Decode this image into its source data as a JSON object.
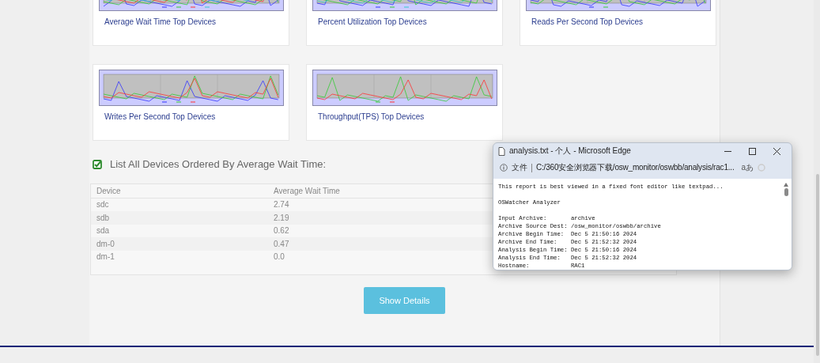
{
  "report_cards": [
    {
      "title": "Average Wait Time Top Devices"
    },
    {
      "title": "Percent Utilization Top Devices"
    },
    {
      "title": "Reads Per Second Top Devices"
    },
    {
      "title": "Writes Per Second Top Devices"
    },
    {
      "title": "Throughput(TPS) Top Devices"
    }
  ],
  "device_section": {
    "heading": "List All Devices Ordered By Average Wait Time:",
    "table": {
      "columns": [
        "Device",
        "Average Wait Time"
      ],
      "rows": [
        [
          "sdc",
          "2.74"
        ],
        [
          "sdb",
          "2.19"
        ],
        [
          "sda",
          "0.62"
        ],
        [
          "dm-0",
          "0.47"
        ],
        [
          "dm-1",
          "0.0"
        ]
      ]
    }
  },
  "show_details_button": "Show Details",
  "popup_window": {
    "title": "analysis.txt - 个人 - Microsoft Edge",
    "address_label": "文件",
    "address": "C:/360安全浏览器下载/osw_monitor/oswbb/analysis/rac1...",
    "reader_label": "aあ",
    "paragraphs": [
      [
        "This report is best viewed in a fixed font editor like textpad..."
      ],
      [
        "OSWatcher Analyzer"
      ],
      [
        "Input Archive:       archive",
        "Archive Source Dest: /osw_monitor/oswbb/archive",
        "Archive Begin Time:  Dec 5 21:50:16 2024",
        "Archive End Time:    Dec 5 21:52:32 2024",
        "Analysis Begin Time: Dec 5 21:50:16 2024",
        "Analysis End Time:   Dec 5 21:52:32 2024",
        "Hostname:            RAC1"
      ]
    ]
  }
}
